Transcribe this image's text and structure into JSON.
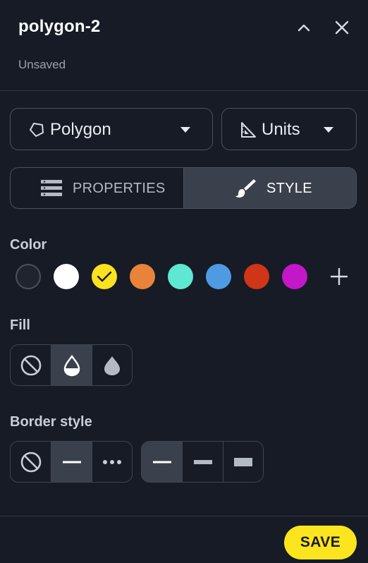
{
  "header": {
    "title": "polygon-2",
    "subtitle": "Unsaved"
  },
  "shape_dropdown": {
    "label": "Polygon",
    "icon": "polygon-icon"
  },
  "units_dropdown": {
    "label": "Units",
    "icon": "ruler-triangle-icon"
  },
  "tabs": [
    {
      "label": "PROPERTIES",
      "icon": "list-icon",
      "active": false
    },
    {
      "label": "STYLE",
      "icon": "paintbrush-icon",
      "active": true
    }
  ],
  "color_section": {
    "label": "Color",
    "swatches": [
      {
        "name": "none",
        "hex": "#1f242d"
      },
      {
        "name": "white",
        "hex": "#ffffff"
      },
      {
        "name": "yellow",
        "hex": "#fbe21f",
        "selected": true
      },
      {
        "name": "orange",
        "hex": "#e8843a"
      },
      {
        "name": "teal",
        "hex": "#5ee8d2"
      },
      {
        "name": "blue",
        "hex": "#4e9be3"
      },
      {
        "name": "red",
        "hex": "#cf3516"
      },
      {
        "name": "magenta",
        "hex": "#c218c8"
      }
    ]
  },
  "fill_section": {
    "label": "Fill",
    "options": [
      "no-fill-icon",
      "partial-fill-drop-icon",
      "solid-fill-drop-icon"
    ],
    "active_index": 1
  },
  "border_section": {
    "label": "Border style",
    "line_types": [
      "no-border-icon",
      "solid-line-icon",
      "dotted-line-icon"
    ],
    "line_types_active": 1,
    "widths": [
      "thin-line-icon",
      "medium-line-icon",
      "thick-line-icon"
    ],
    "widths_active": 0
  },
  "footer": {
    "save_label": "SAVE"
  },
  "colors": {
    "accent": "#fbe51e",
    "background": "#161b26",
    "active_tab": "#3a404c"
  }
}
